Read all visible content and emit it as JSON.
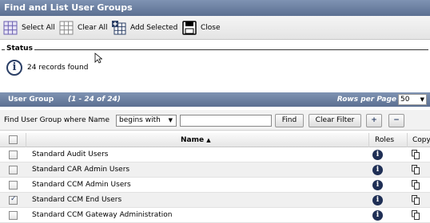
{
  "title": "Find and List User Groups",
  "toolbar": {
    "select_all": "Select All",
    "clear_all": "Clear All",
    "add_selected": "Add Selected",
    "close": "Close"
  },
  "status": {
    "label": "Status",
    "message": "24 records found"
  },
  "group_header": {
    "title": "User Group",
    "range": "(1 - 24 of 24)",
    "rows_per_page_label": "Rows per Page",
    "rows_per_page_value": "50"
  },
  "filter": {
    "label": "Find User Group where Name",
    "match_value": "begins with",
    "search_value": "",
    "find_label": "Find",
    "clear_filter_label": "Clear Filter",
    "add_label": "+",
    "remove_label": "−"
  },
  "table": {
    "columns": {
      "name": "Name",
      "roles": "Roles",
      "copy": "Copy"
    },
    "sort_indicator": "▲",
    "rows": [
      {
        "name": "Standard Audit Users",
        "checked": false
      },
      {
        "name": "Standard CAR Admin Users",
        "checked": false
      },
      {
        "name": "Standard CCM Admin Users",
        "checked": false
      },
      {
        "name": "Standard CCM End Users",
        "checked": true
      },
      {
        "name": "Standard CCM Gateway Administration",
        "checked": false
      }
    ]
  },
  "icons": {
    "info": "info-icon",
    "copy": "copy-icon",
    "grid": "grid-icon",
    "close": "close-icon"
  },
  "colors": {
    "header_blue": "#5b6f91",
    "info_navy": "#1f2f55"
  }
}
